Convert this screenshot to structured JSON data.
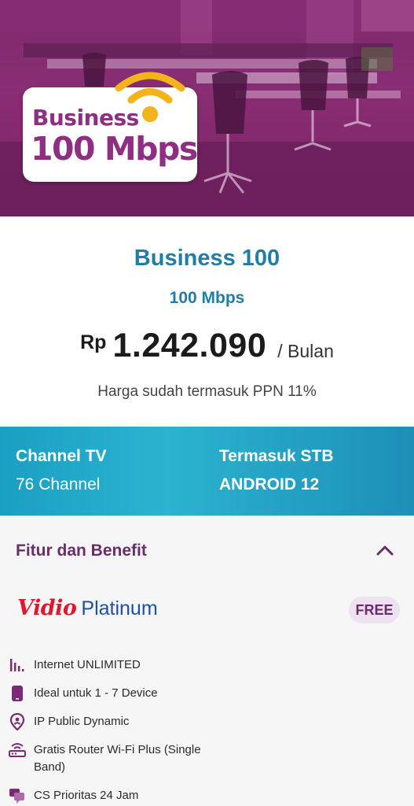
{
  "hero": {
    "badge_line1": "Business",
    "badge_line2": "100 Mbps"
  },
  "plan": {
    "name": "Business 100",
    "speed": "100 Mbps",
    "currency": "Rp",
    "price": "1.242.090",
    "period": "/ Bulan",
    "note": "Harga sudah termasuk PPN 11%"
  },
  "info_bar": {
    "left_title": "Channel TV",
    "left_value": "76 Channel",
    "right_title": "Termasuk STB",
    "right_value": "ANDROID 12"
  },
  "features": {
    "heading": "Fitur dan Benefit",
    "addon_brand": "Vidio",
    "addon_tier": "Platinum",
    "addon_badge": "FREE",
    "items": [
      {
        "icon": "signal-bars-icon",
        "label": "Internet UNLIMITED"
      },
      {
        "icon": "phone-icon",
        "label": "Ideal untuk 1 - 7 Device"
      },
      {
        "icon": "location-pin-icon",
        "label": "IP Public Dynamic"
      },
      {
        "icon": "router-icon",
        "label": "Gratis Router Wi-Fi Plus (Single Band)"
      },
      {
        "icon": "chat-icon",
        "label": "CS Prioritas 24 Jam"
      }
    ]
  },
  "colors": {
    "brand_purple": "#8e2f83",
    "plan_blue": "#1f7ea6",
    "teal": "#1a9fc4",
    "vidio_red": "#e0182d",
    "wifi_gold": "#f2b31b"
  }
}
